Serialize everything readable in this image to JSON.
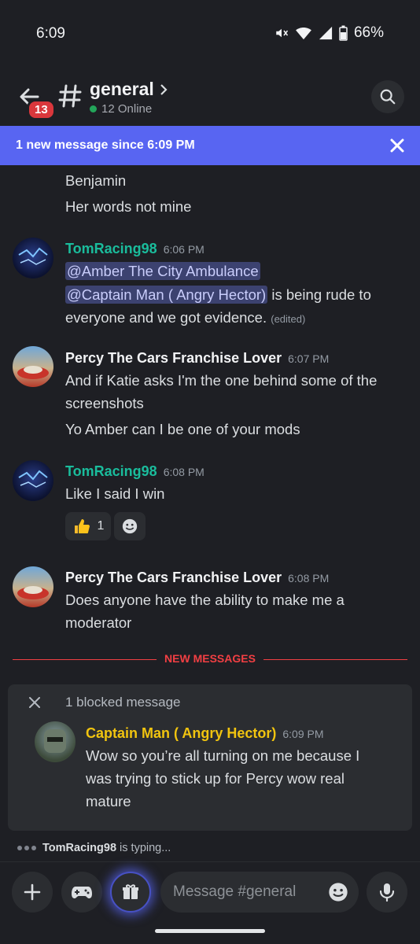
{
  "status": {
    "time": "6:09",
    "battery": "66%"
  },
  "header": {
    "badge": "13",
    "channel": "general",
    "online": "12 Online"
  },
  "banner": {
    "text": "1 new message since 6:09 PM"
  },
  "messages": {
    "partial_1": "Benjamin",
    "partial_2": "Her words not mine",
    "m1": {
      "user": "TomRacing98",
      "time": "6:06 PM",
      "mention_1": "@Amber The City Ambulance",
      "mention_2": "@Captain Man ( Angry Hector)",
      "text_a": " is being rude to",
      "text_b": "everyone and we got evidence.",
      "edited": "(edited)"
    },
    "m2": {
      "user": "Percy The Cars Franchise Lover",
      "time": "6:07 PM",
      "line1": "And if Katie asks I'm the one behind some of the",
      "line2": "screenshots",
      "line3": "Yo Amber can I be one of your mods"
    },
    "m3": {
      "user": "TomRacing98",
      "time": "6:08 PM",
      "line1": "Like I said I win",
      "reaction_count": "1"
    },
    "m4": {
      "user": "Percy The Cars Franchise Lover",
      "time": "6:08 PM",
      "line1": "Does anyone have the ability to make me a",
      "line2": "moderator"
    }
  },
  "new_messages_label": "NEW MESSAGES",
  "blocked": {
    "label": "1 blocked message",
    "user": "Captain Man ( Angry Hector)",
    "time": "6:09 PM",
    "line1": "Wow so you’re all turning on me because I",
    "line2": "was trying to stick up for Percy wow real",
    "line3": "mature"
  },
  "typing": {
    "user": "TomRacing98",
    "suffix": "is typing..."
  },
  "composer": {
    "placeholder": "Message #general"
  },
  "colors": {
    "accent": "#5865f2",
    "tom_name": "#1abc9c",
    "percy_name": "#f2f3f5",
    "captain_name": "#f1c40f",
    "new_messages": "#f23f43"
  }
}
